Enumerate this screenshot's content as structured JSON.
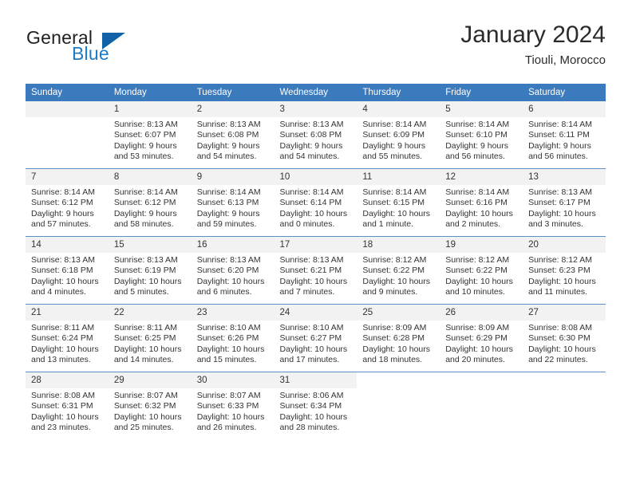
{
  "brand": {
    "name_part1": "General",
    "name_part2": "Blue",
    "accent_color": "#1d7ac4",
    "triangle_color": "#1161a8"
  },
  "header": {
    "title": "January 2024",
    "subtitle": "Tiouli, Morocco",
    "header_bg_color": "#3a7abd",
    "daynum_bg_color": "#f2f2f2"
  },
  "weekday_headers": [
    "Sunday",
    "Monday",
    "Tuesday",
    "Wednesday",
    "Thursday",
    "Friday",
    "Saturday"
  ],
  "weeks": [
    [
      {
        "day": "",
        "sunrise": "",
        "sunset": "",
        "daylight_line1": "",
        "daylight_line2": "",
        "empty": true
      },
      {
        "day": "1",
        "sunrise": "Sunrise: 8:13 AM",
        "sunset": "Sunset: 6:07 PM",
        "daylight_line1": "Daylight: 9 hours",
        "daylight_line2": "and 53 minutes."
      },
      {
        "day": "2",
        "sunrise": "Sunrise: 8:13 AM",
        "sunset": "Sunset: 6:08 PM",
        "daylight_line1": "Daylight: 9 hours",
        "daylight_line2": "and 54 minutes."
      },
      {
        "day": "3",
        "sunrise": "Sunrise: 8:13 AM",
        "sunset": "Sunset: 6:08 PM",
        "daylight_line1": "Daylight: 9 hours",
        "daylight_line2": "and 54 minutes."
      },
      {
        "day": "4",
        "sunrise": "Sunrise: 8:14 AM",
        "sunset": "Sunset: 6:09 PM",
        "daylight_line1": "Daylight: 9 hours",
        "daylight_line2": "and 55 minutes."
      },
      {
        "day": "5",
        "sunrise": "Sunrise: 8:14 AM",
        "sunset": "Sunset: 6:10 PM",
        "daylight_line1": "Daylight: 9 hours",
        "daylight_line2": "and 56 minutes."
      },
      {
        "day": "6",
        "sunrise": "Sunrise: 8:14 AM",
        "sunset": "Sunset: 6:11 PM",
        "daylight_line1": "Daylight: 9 hours",
        "daylight_line2": "and 56 minutes."
      }
    ],
    [
      {
        "day": "7",
        "sunrise": "Sunrise: 8:14 AM",
        "sunset": "Sunset: 6:12 PM",
        "daylight_line1": "Daylight: 9 hours",
        "daylight_line2": "and 57 minutes."
      },
      {
        "day": "8",
        "sunrise": "Sunrise: 8:14 AM",
        "sunset": "Sunset: 6:12 PM",
        "daylight_line1": "Daylight: 9 hours",
        "daylight_line2": "and 58 minutes."
      },
      {
        "day": "9",
        "sunrise": "Sunrise: 8:14 AM",
        "sunset": "Sunset: 6:13 PM",
        "daylight_line1": "Daylight: 9 hours",
        "daylight_line2": "and 59 minutes."
      },
      {
        "day": "10",
        "sunrise": "Sunrise: 8:14 AM",
        "sunset": "Sunset: 6:14 PM",
        "daylight_line1": "Daylight: 10 hours",
        "daylight_line2": "and 0 minutes."
      },
      {
        "day": "11",
        "sunrise": "Sunrise: 8:14 AM",
        "sunset": "Sunset: 6:15 PM",
        "daylight_line1": "Daylight: 10 hours",
        "daylight_line2": "and 1 minute."
      },
      {
        "day": "12",
        "sunrise": "Sunrise: 8:14 AM",
        "sunset": "Sunset: 6:16 PM",
        "daylight_line1": "Daylight: 10 hours",
        "daylight_line2": "and 2 minutes."
      },
      {
        "day": "13",
        "sunrise": "Sunrise: 8:13 AM",
        "sunset": "Sunset: 6:17 PM",
        "daylight_line1": "Daylight: 10 hours",
        "daylight_line2": "and 3 minutes."
      }
    ],
    [
      {
        "day": "14",
        "sunrise": "Sunrise: 8:13 AM",
        "sunset": "Sunset: 6:18 PM",
        "daylight_line1": "Daylight: 10 hours",
        "daylight_line2": "and 4 minutes."
      },
      {
        "day": "15",
        "sunrise": "Sunrise: 8:13 AM",
        "sunset": "Sunset: 6:19 PM",
        "daylight_line1": "Daylight: 10 hours",
        "daylight_line2": "and 5 minutes."
      },
      {
        "day": "16",
        "sunrise": "Sunrise: 8:13 AM",
        "sunset": "Sunset: 6:20 PM",
        "daylight_line1": "Daylight: 10 hours",
        "daylight_line2": "and 6 minutes."
      },
      {
        "day": "17",
        "sunrise": "Sunrise: 8:13 AM",
        "sunset": "Sunset: 6:21 PM",
        "daylight_line1": "Daylight: 10 hours",
        "daylight_line2": "and 7 minutes."
      },
      {
        "day": "18",
        "sunrise": "Sunrise: 8:12 AM",
        "sunset": "Sunset: 6:22 PM",
        "daylight_line1": "Daylight: 10 hours",
        "daylight_line2": "and 9 minutes."
      },
      {
        "day": "19",
        "sunrise": "Sunrise: 8:12 AM",
        "sunset": "Sunset: 6:22 PM",
        "daylight_line1": "Daylight: 10 hours",
        "daylight_line2": "and 10 minutes."
      },
      {
        "day": "20",
        "sunrise": "Sunrise: 8:12 AM",
        "sunset": "Sunset: 6:23 PM",
        "daylight_line1": "Daylight: 10 hours",
        "daylight_line2": "and 11 minutes."
      }
    ],
    [
      {
        "day": "21",
        "sunrise": "Sunrise: 8:11 AM",
        "sunset": "Sunset: 6:24 PM",
        "daylight_line1": "Daylight: 10 hours",
        "daylight_line2": "and 13 minutes."
      },
      {
        "day": "22",
        "sunrise": "Sunrise: 8:11 AM",
        "sunset": "Sunset: 6:25 PM",
        "daylight_line1": "Daylight: 10 hours",
        "daylight_line2": "and 14 minutes."
      },
      {
        "day": "23",
        "sunrise": "Sunrise: 8:10 AM",
        "sunset": "Sunset: 6:26 PM",
        "daylight_line1": "Daylight: 10 hours",
        "daylight_line2": "and 15 minutes."
      },
      {
        "day": "24",
        "sunrise": "Sunrise: 8:10 AM",
        "sunset": "Sunset: 6:27 PM",
        "daylight_line1": "Daylight: 10 hours",
        "daylight_line2": "and 17 minutes."
      },
      {
        "day": "25",
        "sunrise": "Sunrise: 8:09 AM",
        "sunset": "Sunset: 6:28 PM",
        "daylight_line1": "Daylight: 10 hours",
        "daylight_line2": "and 18 minutes."
      },
      {
        "day": "26",
        "sunrise": "Sunrise: 8:09 AM",
        "sunset": "Sunset: 6:29 PM",
        "daylight_line1": "Daylight: 10 hours",
        "daylight_line2": "and 20 minutes."
      },
      {
        "day": "27",
        "sunrise": "Sunrise: 8:08 AM",
        "sunset": "Sunset: 6:30 PM",
        "daylight_line1": "Daylight: 10 hours",
        "daylight_line2": "and 22 minutes."
      }
    ],
    [
      {
        "day": "28",
        "sunrise": "Sunrise: 8:08 AM",
        "sunset": "Sunset: 6:31 PM",
        "daylight_line1": "Daylight: 10 hours",
        "daylight_line2": "and 23 minutes."
      },
      {
        "day": "29",
        "sunrise": "Sunrise: 8:07 AM",
        "sunset": "Sunset: 6:32 PM",
        "daylight_line1": "Daylight: 10 hours",
        "daylight_line2": "and 25 minutes."
      },
      {
        "day": "30",
        "sunrise": "Sunrise: 8:07 AM",
        "sunset": "Sunset: 6:33 PM",
        "daylight_line1": "Daylight: 10 hours",
        "daylight_line2": "and 26 minutes."
      },
      {
        "day": "31",
        "sunrise": "Sunrise: 8:06 AM",
        "sunset": "Sunset: 6:34 PM",
        "daylight_line1": "Daylight: 10 hours",
        "daylight_line2": "and 28 minutes."
      },
      {
        "day": "",
        "sunrise": "",
        "sunset": "",
        "daylight_line1": "",
        "daylight_line2": "",
        "none": true
      },
      {
        "day": "",
        "sunrise": "",
        "sunset": "",
        "daylight_line1": "",
        "daylight_line2": "",
        "none": true
      },
      {
        "day": "",
        "sunrise": "",
        "sunset": "",
        "daylight_line1": "",
        "daylight_line2": "",
        "none": true
      }
    ]
  ]
}
